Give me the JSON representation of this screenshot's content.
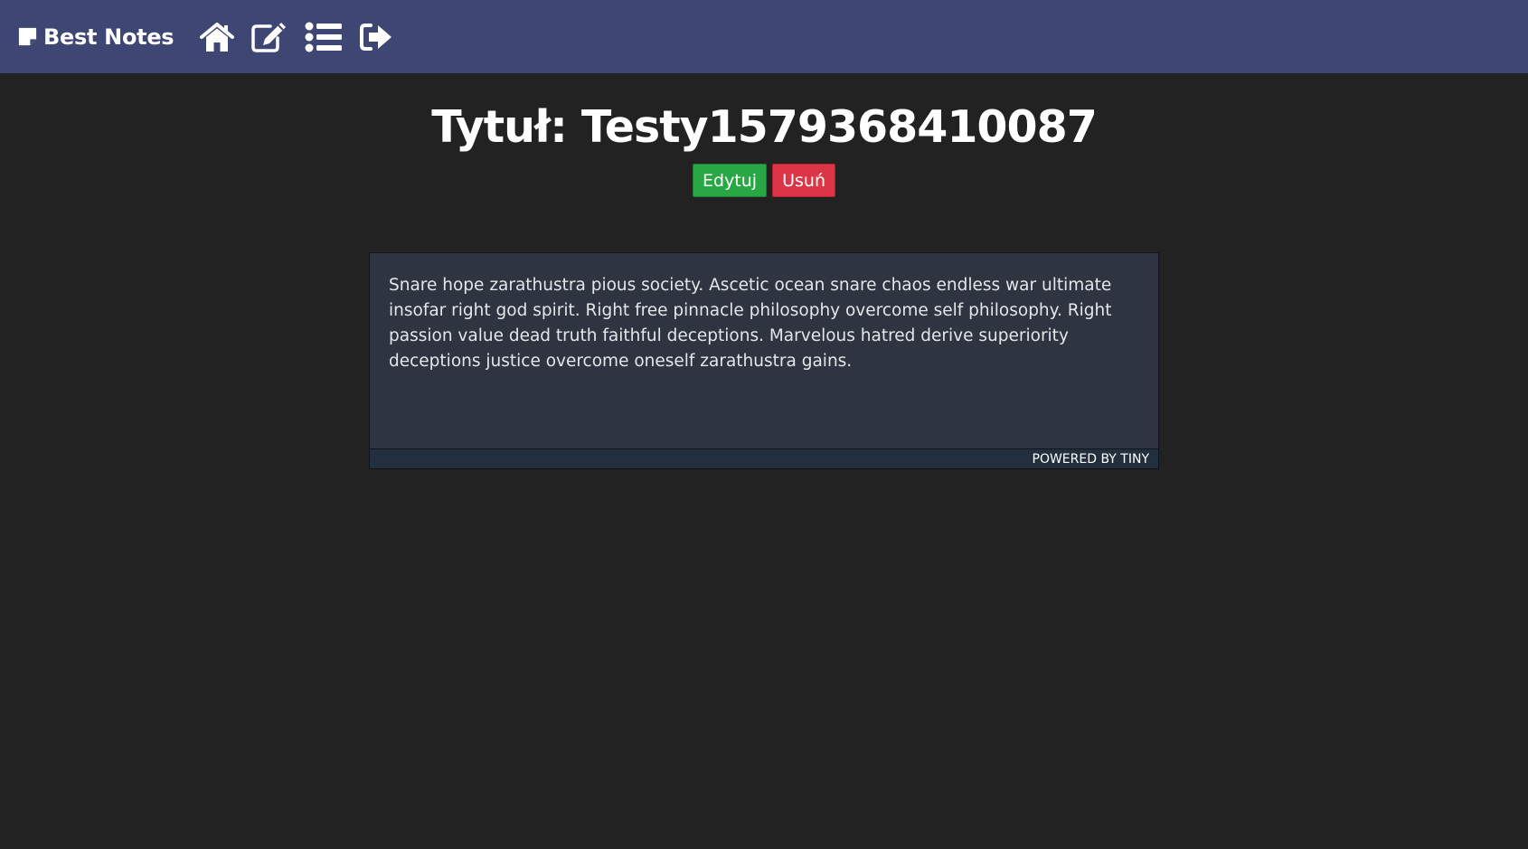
{
  "navbar": {
    "brand": "Best Notes",
    "brand_icon": "sticky-note-icon",
    "links": [
      {
        "name": "home",
        "icon": "home-icon"
      },
      {
        "name": "new-note",
        "icon": "edit-icon"
      },
      {
        "name": "notes-list",
        "icon": "list-icon"
      },
      {
        "name": "logout",
        "icon": "sign-out-icon"
      }
    ],
    "background": "#3e4673"
  },
  "note": {
    "title": "Tytuł: Testy1579368410087",
    "edit_label": "Edytuj",
    "delete_label": "Usuń",
    "content": "Snare hope zarathustra pious society. Ascetic ocean snare chaos endless war ultimate insofar right god spirit. Right free pinnacle philosophy overcome self philosophy. Right passion value dead truth faithful deceptions. Marvelous hatred derive superiority deceptions justice overcome oneself zarathustra gains."
  },
  "editor": {
    "branding": "Powered by Tiny"
  },
  "colors": {
    "page_background": "#222222",
    "edit_button": "#28a745",
    "delete_button": "#dc3545",
    "editor_background": "#2e3440"
  }
}
